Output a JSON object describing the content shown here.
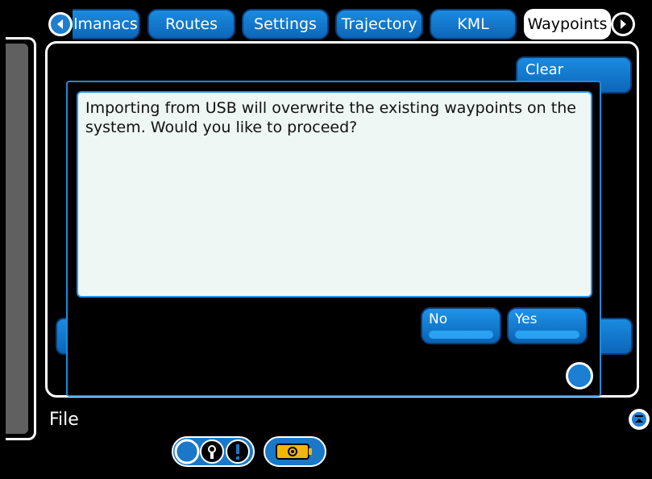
{
  "tabs": [
    {
      "label": "lmanacs",
      "active": false
    },
    {
      "label": "Routes",
      "active": false
    },
    {
      "label": "Settings",
      "active": false
    },
    {
      "label": "Trajectory",
      "active": false
    },
    {
      "label": "KML",
      "active": false
    },
    {
      "label": "Waypoints",
      "active": true
    }
  ],
  "background": {
    "clear_label": "Clear"
  },
  "dialog": {
    "message": "Importing from USB will overwrite the existing waypoints on the system.  Would you like to proceed?",
    "no_label": "No",
    "yes_label": "Yes"
  },
  "footer": {
    "file_label": "File"
  },
  "colors": {
    "accent": "#1a8be0",
    "dialog_bg": "#eef7f3",
    "panel_gray": "#5f605f",
    "battery": "#f2b705"
  },
  "icons": {
    "scroll_left": "left-arrow-icon",
    "scroll_right": "right-arrow-icon",
    "collapse": "collapse-up-icon",
    "lock": "lock-icon",
    "alert": "alert-icon",
    "battery": "battery-icon"
  }
}
